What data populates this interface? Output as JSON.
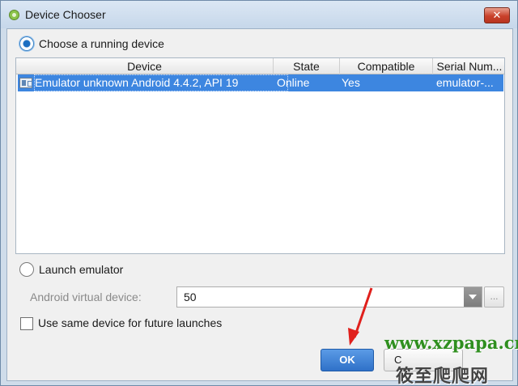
{
  "window": {
    "title": "Device Chooser",
    "close_label": "✕"
  },
  "running": {
    "label": "Choose a running device",
    "selected": true
  },
  "table": {
    "columns": [
      "Device",
      "State",
      "Compatible",
      "Serial Num..."
    ],
    "rows": [
      {
        "device": "Emulator unknown Android 4.4.2, API 19",
        "state": "Online",
        "compatible": "Yes",
        "serial": "emulator-..."
      }
    ]
  },
  "launch": {
    "label": "Launch emulator",
    "selected": false,
    "avd_label": "Android virtual device:",
    "avd_value": "50",
    "browse_label": "..."
  },
  "reuse": {
    "label": "Use same device for future launches",
    "checked": false
  },
  "buttons": {
    "ok": "OK",
    "cancel": "C"
  },
  "watermark": {
    "url": "www.xzpapa.cn",
    "site": "筱至爬爬网"
  },
  "colors": {
    "selection": "#3d86e0",
    "ok_button": "#2f71c8",
    "arrow": "#e0201c"
  }
}
